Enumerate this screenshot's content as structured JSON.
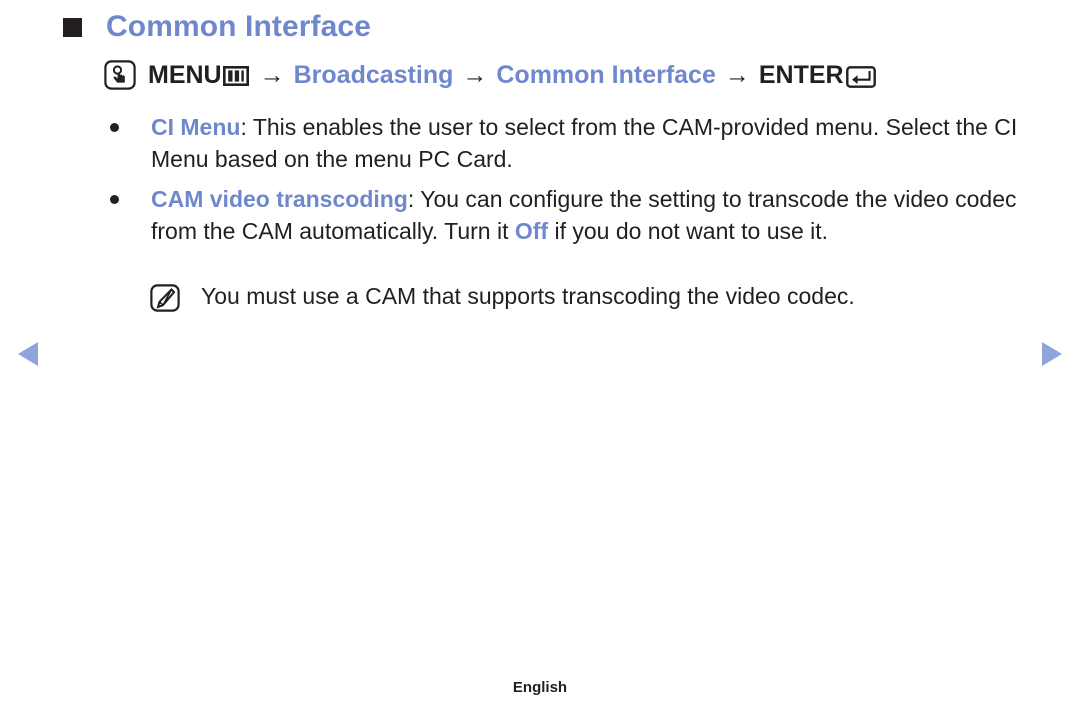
{
  "page": {
    "heading": "Common Interface",
    "accent_color": "#6f88cd",
    "text_color": "#231f20"
  },
  "menu_path": {
    "oo_icon": "touch-press-icon",
    "menu_label": "MENU",
    "menu_glyph": "menu-grid-icon",
    "arrow": "→",
    "step2": "Broadcasting",
    "step3": "Common Interface",
    "enter_label": "ENTER",
    "enter_glyph": "enter-return-key-icon"
  },
  "bullets": [
    {
      "keyword": "CI Menu",
      "rest": ": This enables the user to select from the CAM-provided menu. Select the CI Menu based on the menu PC Card."
    },
    {
      "keyword": "CAM video transcoding",
      "part1": ": You can configure the setting to transcode the video codec from the CAM automatically. Turn it ",
      "emphasis": "Off",
      "part2": " if you do not want to use it."
    }
  ],
  "note": {
    "icon": "note-pencil-icon",
    "text": "You must use a CAM that supports transcoding the video codec."
  },
  "nav": {
    "prev_icon": "triangle-left-icon",
    "next_icon": "triangle-right-icon",
    "arrow_color": "#8fa3dc"
  },
  "footer": {
    "language": "English"
  }
}
